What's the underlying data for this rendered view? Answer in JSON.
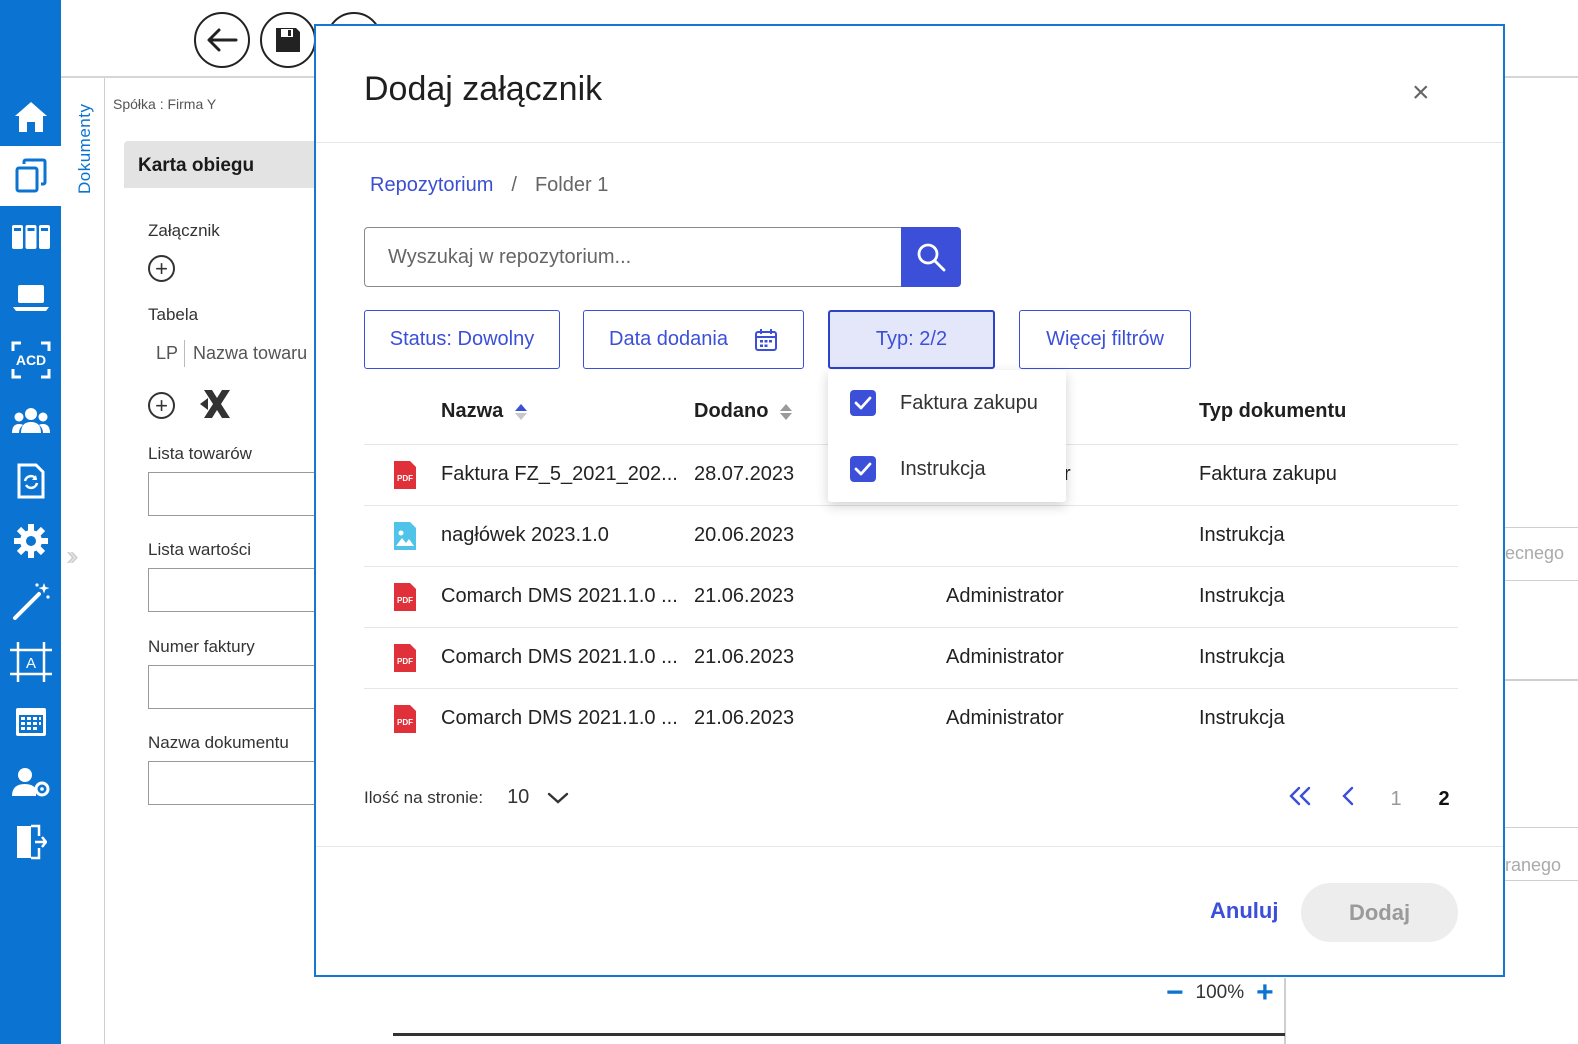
{
  "app": {
    "side_tab_label": "Dokumenty",
    "company_label": "Spółka : Firma Y",
    "card_tab": "Karta obiegu",
    "form": {
      "attachment_label": "Załącznik",
      "table_label": "Tabela",
      "table_columns": [
        "LP",
        "Nazwa towaru"
      ],
      "goods_list_label": "Lista towarów",
      "values_list_label": "Lista wartości",
      "invoice_number_label": "Numer faktury",
      "document_name_label": "Nazwa dokumentu"
    },
    "right_fragments": [
      "ecnego",
      "ranego"
    ],
    "zoom": {
      "minus": "−",
      "value": "100%",
      "plus": "+"
    }
  },
  "nav": {
    "items": [
      "home-icon",
      "documents-icon",
      "columns-icon",
      "laptop-icon",
      "ocr-icon",
      "users-icon",
      "document-refresh-icon",
      "gear-icon",
      "wand-icon",
      "template-icon",
      "calendar-icon",
      "user-settings-icon",
      "logout-icon"
    ],
    "active_index": 1,
    "color": "#0B73D1"
  },
  "modal": {
    "title": "Dodaj załącznik",
    "close": "×",
    "breadcrumb": {
      "root": "Repozytorium",
      "separator": "/",
      "current": "Folder 1"
    },
    "search": {
      "placeholder": "Wyszukaj w repozytorium...",
      "value": ""
    },
    "filters": {
      "status": "Status: Dowolny",
      "date": "Data dodania",
      "type": "Typ: 2/2",
      "more": "Więcej filtrów"
    },
    "type_dropdown": {
      "options": [
        {
          "label": "Faktura zakupu",
          "checked": true
        },
        {
          "label": "Instrukcja",
          "checked": true
        }
      ]
    },
    "table": {
      "columns": {
        "name": "Nazwa",
        "added": "Dodano",
        "type": "Typ dokumentu"
      },
      "rows": [
        {
          "icon": "pdf-icon",
          "name": "Faktura FZ_5_2021_202...",
          "added": "28.07.2023",
          "author_fragment": "r",
          "type": "Faktura zakupu"
        },
        {
          "icon": "image-icon",
          "name": "nagłówek 2023.1.0",
          "added": "20.06.2023",
          "author": "",
          "type": "Instrukcja"
        },
        {
          "icon": "pdf-icon",
          "name": "Comarch DMS 2021.1.0 ...",
          "added": "21.06.2023",
          "author": "Administrator",
          "type": "Instrukcja"
        },
        {
          "icon": "pdf-icon",
          "name": "Comarch DMS 2021.1.0 ...",
          "added": "21.06.2023",
          "author": "Administrator",
          "type": "Instrukcja"
        },
        {
          "icon": "pdf-icon",
          "name": "Comarch DMS 2021.1.0 ...",
          "added": "21.06.2023",
          "author": "Administrator",
          "type": "Instrukcja"
        }
      ]
    },
    "pagination": {
      "page_size_label": "Ilość na stronie:",
      "page_size": "10",
      "first": "«",
      "prev": "‹",
      "pages": [
        "1",
        "2"
      ],
      "current_page": "2"
    },
    "buttons": {
      "cancel": "Anuluj",
      "add": "Dodaj"
    },
    "accent_color": "#3b4fd8"
  }
}
